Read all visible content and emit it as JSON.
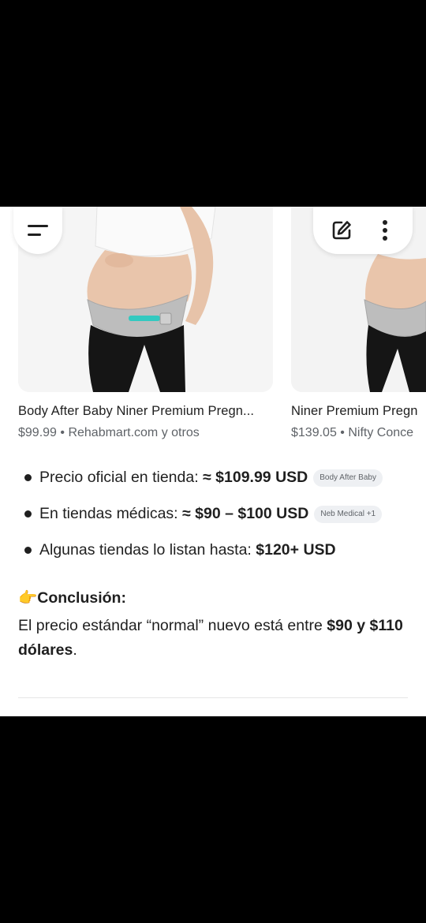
{
  "products": [
    {
      "title": "Body After Baby Niner Premium Pregn...",
      "price": "$99.99",
      "seller": "Rehabmart.com y otros"
    },
    {
      "title": "Niner Premium Pregn",
      "price": "$139.05",
      "seller": "Nifty Conce"
    }
  ],
  "bullets": [
    {
      "text": "Precio oficial en tienda: ",
      "strong": "≈ $109.99 USD",
      "chip": "Body After Baby"
    },
    {
      "text": "En tiendas médicas: ",
      "strong": "≈ $90 – $100 USD",
      "chip": "Neb Medical +1"
    },
    {
      "text": "Algunas tiendas lo listan hasta: ",
      "strong": "$120+ USD",
      "chip": ""
    }
  ],
  "conclusion": {
    "emoji": "👉",
    "heading": "Conclusión:",
    "text_before": "El precio estándar “normal” nuevo está entre ",
    "strong": "$90 y $110 dólares",
    "text_after": "."
  },
  "icons": {
    "menu": "menu-icon",
    "edit": "edit-icon",
    "more": "more-vert-icon"
  },
  "colors": {
    "background": "#000000",
    "sheet": "#ffffff",
    "text": "#1f1f1f",
    "muted": "#5f6368",
    "chip_bg": "#eef0f3",
    "accent_band": "#33c9c0"
  }
}
